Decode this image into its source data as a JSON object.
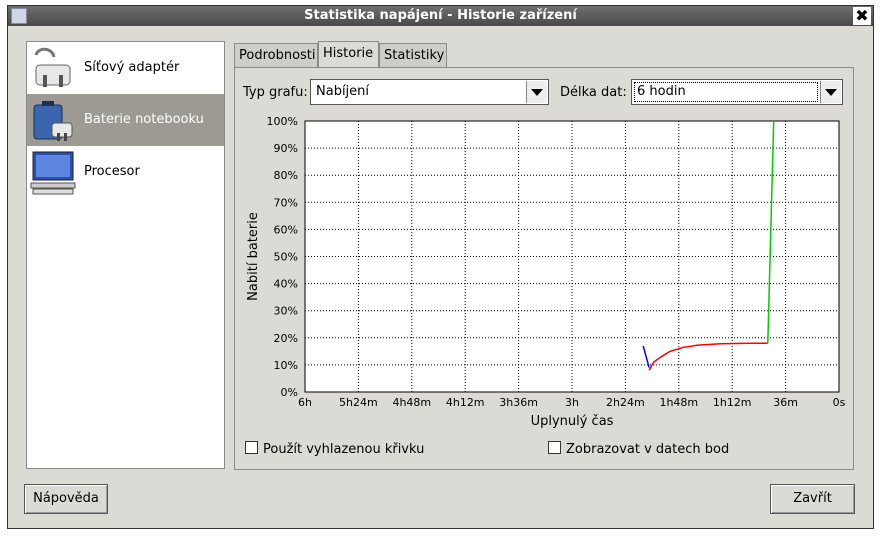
{
  "window": {
    "title": "Statistika napájení - Historie zařízení"
  },
  "devices": [
    {
      "label": "Síťový adaptér",
      "icon": "ac-adapter-icon"
    },
    {
      "label": "Baterie notebooku",
      "icon": "laptop-battery-icon",
      "selected": true
    },
    {
      "label": "Procesor",
      "icon": "computer-processor-icon"
    }
  ],
  "tabs": [
    {
      "label": "Podrobnosti"
    },
    {
      "label": "Historie",
      "active": true
    },
    {
      "label": "Statistiky"
    }
  ],
  "controls": {
    "graph_type_label": "Typ grafu:",
    "graph_type_value": "Nabíjení",
    "data_length_label": "Délka dat:",
    "data_length_value": "6 hodin"
  },
  "chart_data": {
    "type": "line",
    "xlabel": "Uplynulý čas",
    "ylabel": "Nabití baterie",
    "x_ticks": [
      "6h",
      "5h24m",
      "4h48m",
      "4h12m",
      "3h36m",
      "3h",
      "2h24m",
      "1h48m",
      "1h12m",
      "36m",
      "0s"
    ],
    "y_ticks": [
      "100%",
      "90%",
      "80%",
      "70%",
      "60%",
      "50%",
      "40%",
      "30%",
      "20%",
      "10%",
      "0%"
    ],
    "x_range_min": [
      360,
      0
    ],
    "y_range": [
      0,
      100
    ],
    "grid": true,
    "series": [
      {
        "color": "#0000ff",
        "points": [
          [
            132,
            17
          ],
          [
            128,
            9
          ]
        ]
      },
      {
        "color": "#ff0000",
        "points": [
          [
            128,
            8
          ],
          [
            125,
            11
          ],
          [
            120,
            13
          ],
          [
            114,
            15
          ],
          [
            105,
            16.5
          ],
          [
            95,
            17.3
          ],
          [
            80,
            17.8
          ],
          [
            60,
            18
          ],
          [
            48,
            18
          ]
        ]
      },
      {
        "color": "#00cc00",
        "points": [
          [
            48,
            18
          ],
          [
            44,
            100
          ]
        ]
      }
    ]
  },
  "options": {
    "smooth_label": "Použít vyhlazenou křivku",
    "points_label": "Zobrazovat v datech bod"
  },
  "buttons": {
    "help": "Nápověda",
    "close": "Zavřít"
  }
}
